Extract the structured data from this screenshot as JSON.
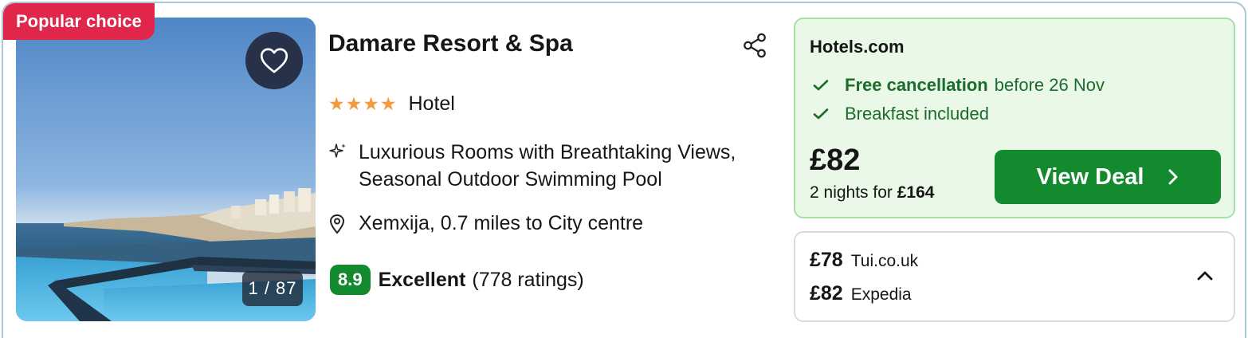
{
  "badge": "Popular choice",
  "photo": {
    "counter": "1 / 87"
  },
  "hotel": {
    "name": "Damare Resort & Spa",
    "stars": "★★★★",
    "star_count": 4,
    "type": "Hotel",
    "feature": "Luxurious Rooms with Breathtaking Views, Seasonal Outdoor Swimming Pool",
    "location": "Xemxija, 0.7 miles to City centre",
    "score": "8.9",
    "score_word": "Excellent",
    "ratings": "(778 ratings)"
  },
  "deal": {
    "provider": "Hotels.com",
    "perks": [
      {
        "strong": "Free cancellation",
        "text": "before 26 Nov"
      },
      {
        "strong": "",
        "text": "Breakfast included"
      }
    ],
    "price": "£82",
    "nights_prefix": "2 nights for",
    "nights_total": "£164",
    "button_label": "View Deal"
  },
  "alternatives": [
    {
      "price": "£78",
      "site": "Tui.co.uk"
    },
    {
      "price": "£82",
      "site": "Expedia"
    }
  ],
  "colors": {
    "badge": "#e0264a",
    "accent_green": "#138a2e",
    "deal_bg": "#e9f8e7",
    "star": "#f29a3d"
  }
}
